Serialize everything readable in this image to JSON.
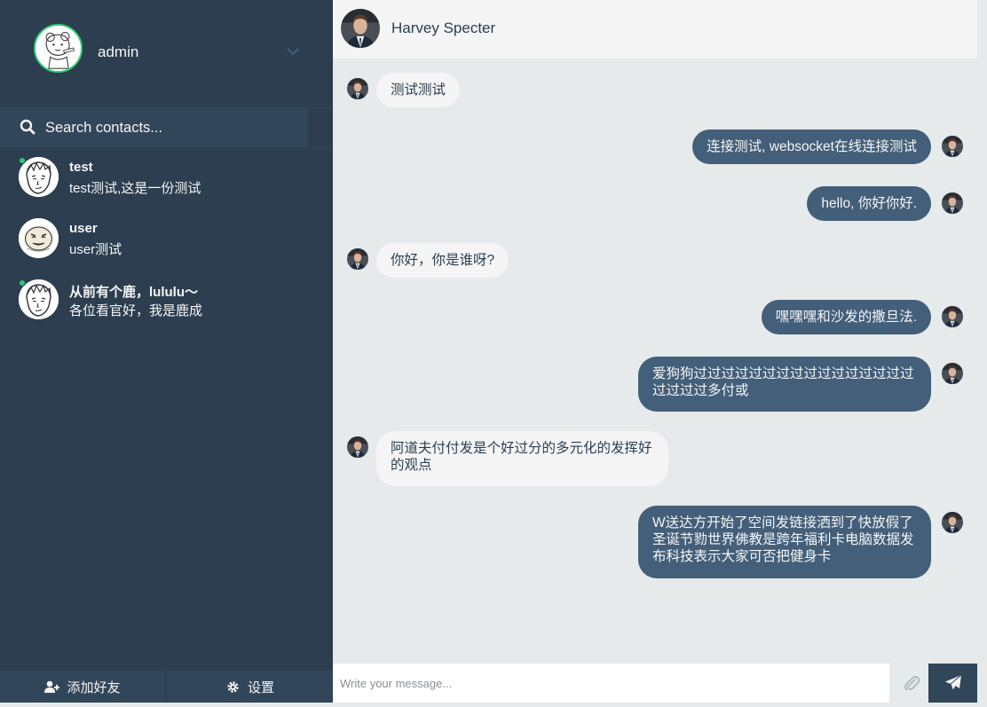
{
  "profile": {
    "name": "admin"
  },
  "search": {
    "placeholder": "Search contacts..."
  },
  "contacts": [
    {
      "name": "test",
      "preview": "test测试,这是一份测试",
      "online": true
    },
    {
      "name": "user",
      "preview": "user测试",
      "online": false
    },
    {
      "name": "从前有个鹿，lululu～",
      "preview": "各位看官好，我是鹿成",
      "online": true
    }
  ],
  "bottom_bar": {
    "add_contact": "添加好友",
    "settings": "设置"
  },
  "header": {
    "contact_name": "Harvey Specter"
  },
  "messages": [
    {
      "direction": "received",
      "text": "测试测试"
    },
    {
      "direction": "sent",
      "text": "连接测试, websocket在线连接测试"
    },
    {
      "direction": "sent",
      "text": "hello, 你好你好."
    },
    {
      "direction": "received",
      "text": "你好，你是谁呀?"
    },
    {
      "direction": "sent",
      "text": "嘿嘿嘿和沙发的撒旦法."
    },
    {
      "direction": "sent",
      "text": "爱狗狗过过过过过过过过过过过过过过过过过过过过多付或"
    },
    {
      "direction": "received",
      "text": "阿道夫付付发是个好过分的多元化的发挥好的观点"
    },
    {
      "direction": "sent",
      "text": "W送达方开始了空间发链接洒到了快放假了圣诞节勠世界佛教是跨年福利卡电脑数据发布科技表示大家可否把健身卡"
    }
  ],
  "composer": {
    "placeholder": "Write your message..."
  },
  "colors": {
    "sidebar_bg": "#2c3e50",
    "sidebar_panel": "#32465a",
    "online": "#2ecc71",
    "sent_bubble": "#435f7a",
    "received_bubble": "#f5f5f5",
    "chat_bg": "#e6eaea"
  },
  "icons": [
    "chevron-down-icon",
    "search-icon",
    "user-plus-icon",
    "gear-icon",
    "paperclip-icon",
    "paper-plane-icon"
  ]
}
